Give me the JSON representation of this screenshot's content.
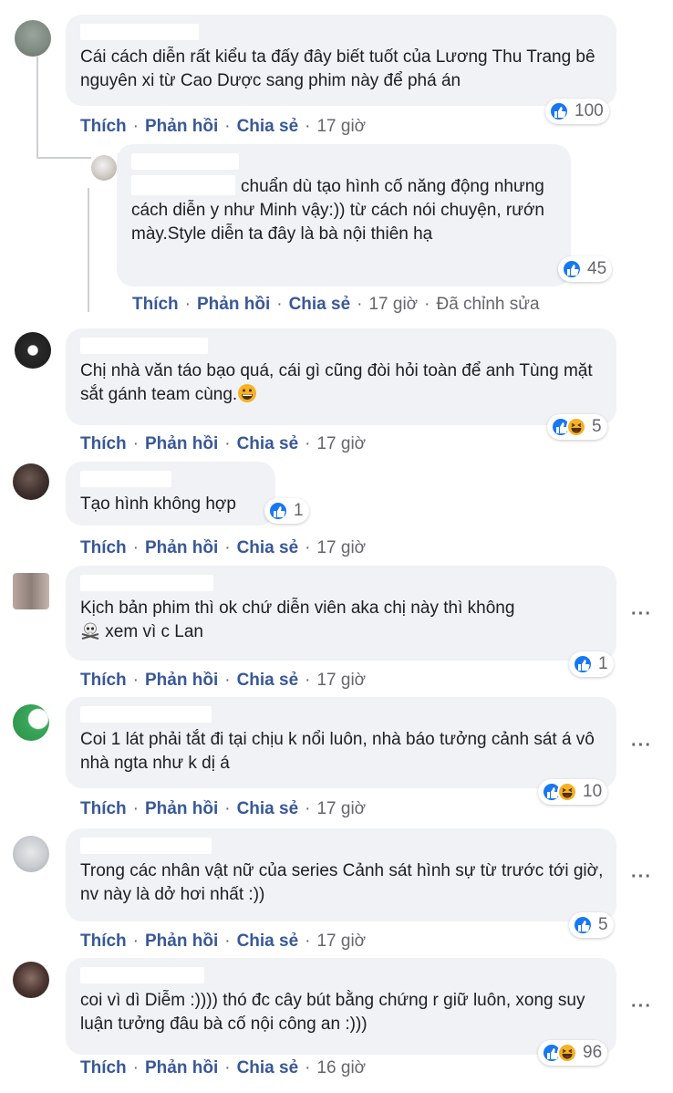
{
  "actions": {
    "like": "Thích",
    "reply": "Phản hồi",
    "share": "Chia sẻ",
    "edited": "Đã chỉnh sửa"
  },
  "colors": {
    "like_blue": "#1877f2",
    "action_link": "#385898",
    "bubble_bg": "#f0f2f5",
    "meta_gray": "#65676b"
  },
  "comments": [
    {
      "text": "Cái cách diễn rất kiểu ta đấy đây biết tuốt của Lương Thu Trang bê nguyên xi từ Cao Dược sang phim này để phá án",
      "time": "17 giờ",
      "reactions": {
        "icons": [
          "like-icon"
        ],
        "count": "100"
      }
    },
    {
      "text": "chuẩn dù tạo hình cố năng động nhưng cách diễn y như Minh vậy:)) từ cách nói chuyện, rướn mày.Style diễn ta đây là bà nội thiên hạ",
      "time": "17 giờ",
      "reactions": {
        "icons": [
          "like-icon"
        ],
        "count": "45"
      }
    },
    {
      "text": "Chị nhà văn táo bạo quá, cái gì cũng đòi hỏi toàn để anh Tùng mặt sắt gánh team cùng.",
      "time": "17 giờ",
      "reactions": {
        "icons": [
          "like-icon",
          "haha-icon"
        ],
        "count": "5"
      }
    },
    {
      "text": "Tạo hình không hợp",
      "time": "17 giờ",
      "reactions": {
        "icons": [
          "like-icon"
        ],
        "count": "1"
      }
    },
    {
      "text_a": "Kịch bản phim thì ok chứ diễn viên aka chị này thì không",
      "text_b": "xem vì c Lan",
      "time": "17 giờ",
      "reactions": {
        "icons": [
          "like-icon"
        ],
        "count": "1"
      }
    },
    {
      "text": "Coi 1 lát phải tắt đi tại chịu k nổi luôn, nhà báo tưởng cảnh sát á vô nhà ngta như k dị á",
      "time": "17 giờ",
      "reactions": {
        "icons": [
          "like-icon",
          "haha-icon"
        ],
        "count": "10"
      }
    },
    {
      "text": "Trong các nhân vật nữ của series Cảnh sát hình sự từ trước tới giờ, nv này là dở hơi nhất :))",
      "time": "17 giờ",
      "reactions": {
        "icons": [
          "like-icon"
        ],
        "count": "5"
      }
    },
    {
      "text": "coi vì dì Diễm :)))) thó đc cây bút bằng chứng r giữ luôn, xong suy luận tưởng đâu bà cố nội công an :)))",
      "time": "16 giờ",
      "reactions": {
        "icons": [
          "like-icon",
          "haha-icon"
        ],
        "count": "96"
      }
    }
  ]
}
